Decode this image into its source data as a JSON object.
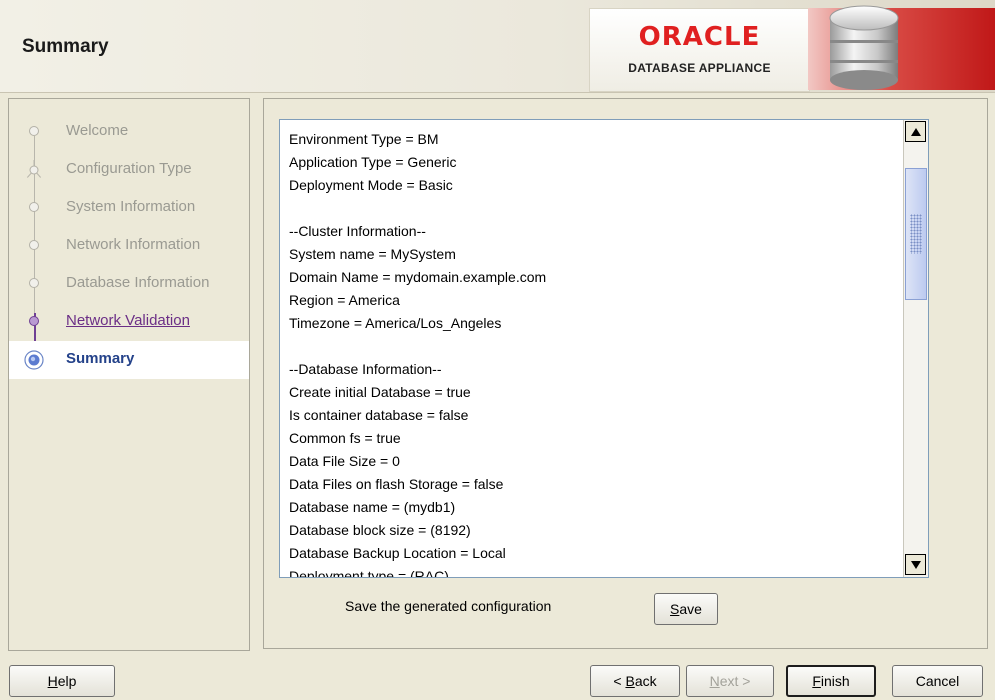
{
  "header": {
    "title": "Summary",
    "logo": {
      "brand": "ORACLE",
      "product": "DATABASE APPLIANCE"
    }
  },
  "nav": {
    "items": [
      {
        "label": "Welcome",
        "state": "pending"
      },
      {
        "label": "Configuration Type",
        "state": "pending"
      },
      {
        "label": "System Information",
        "state": "pending"
      },
      {
        "label": "Network Information",
        "state": "pending"
      },
      {
        "label": "Database Information",
        "state": "pending"
      },
      {
        "label": "Network Validation",
        "state": "visited"
      },
      {
        "label": "Summary",
        "state": "current"
      }
    ]
  },
  "summary": {
    "lines": [
      "Environment Type = BM",
      "Application Type = Generic",
      "Deployment Mode = Basic",
      "",
      "--Cluster Information--",
      "System name = MySystem",
      "Domain Name = mydomain.example.com",
      "Region = America",
      "Timezone = America/Los_Angeles",
      "",
      "--Database Information--",
      "Create initial Database = true",
      "Is container database = false",
      "Common fs = true",
      "Data File Size = 0",
      "Data Files on flash Storage = false",
      "Database name = (mydb1)",
      "Database block size = (8192)",
      "Database Backup Location = Local",
      "Deployment type = (RAC)"
    ],
    "save_label": "Save the generated configuration",
    "save_button": {
      "label": "Save",
      "mnemonic": "S"
    }
  },
  "buttons": {
    "help": {
      "label": "Help",
      "mnemonic": "H"
    },
    "back": {
      "prefix": "< ",
      "mnemonic": "B",
      "rest": "ack"
    },
    "next": {
      "label": "Next >",
      "mnemonic": "N"
    },
    "finish": {
      "label": "Finish",
      "mnemonic": "F"
    },
    "cancel": {
      "label": "Cancel"
    }
  },
  "colors": {
    "oracle_red": "#e02020",
    "visited_purple": "#6b2e86",
    "current_blue": "#24428a",
    "panel_bg": "#ece9d8"
  }
}
